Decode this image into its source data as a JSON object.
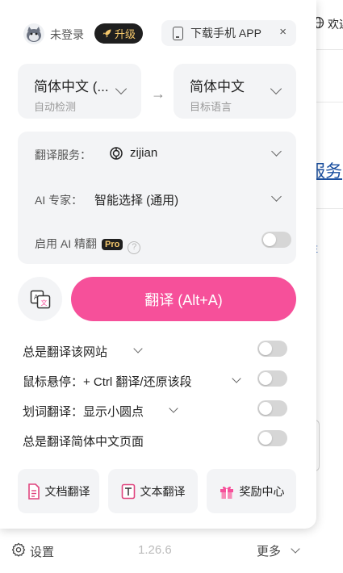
{
  "background": {
    "topbar_text": "欢迎",
    "link_text": "服务",
    "fragment": "E"
  },
  "header": {
    "login_status": "未登录",
    "upgrade_label": "升级",
    "download_app_label": "下载手机 APP",
    "close_glyph": "×"
  },
  "languages": {
    "source": {
      "name": "简体中文 (...",
      "caption": "自动检测"
    },
    "target": {
      "name": "简体中文",
      "caption": "目标语言"
    },
    "swap_arrow": "→"
  },
  "settings": {
    "service_label": "翻译服务：",
    "service_value": "zijian",
    "expert_label": "AI 专家：",
    "expert_value": "智能选择 (通用)",
    "ai_polish_label": "启用 AI 精翻",
    "pro_badge": "Pro",
    "help_glyph": "?",
    "ai_polish_enabled": false
  },
  "translate_button": "翻译 (Alt+A)",
  "options": [
    {
      "label": "总是翻译该网站",
      "enabled": false
    },
    {
      "label": "鼠标悬停：+ Ctrl 翻译/还原该段",
      "enabled": false
    },
    {
      "label": "划词翻译：显示小圆点",
      "enabled": false
    },
    {
      "label": "总是翻译简体中文页面",
      "enabled": false
    }
  ],
  "bottom_buttons": {
    "doc_translate": "文档翻译",
    "text_translate": "文本翻译",
    "rewards": "奖励中心"
  },
  "footer": {
    "settings_label": "设置",
    "version": "1.26.6",
    "more_label": "更多"
  },
  "colors": {
    "accent": "#f6509a",
    "card_bg": "#f3f4f6",
    "badge_bg": "#1f1f1f",
    "badge_text": "#f4c76b"
  }
}
